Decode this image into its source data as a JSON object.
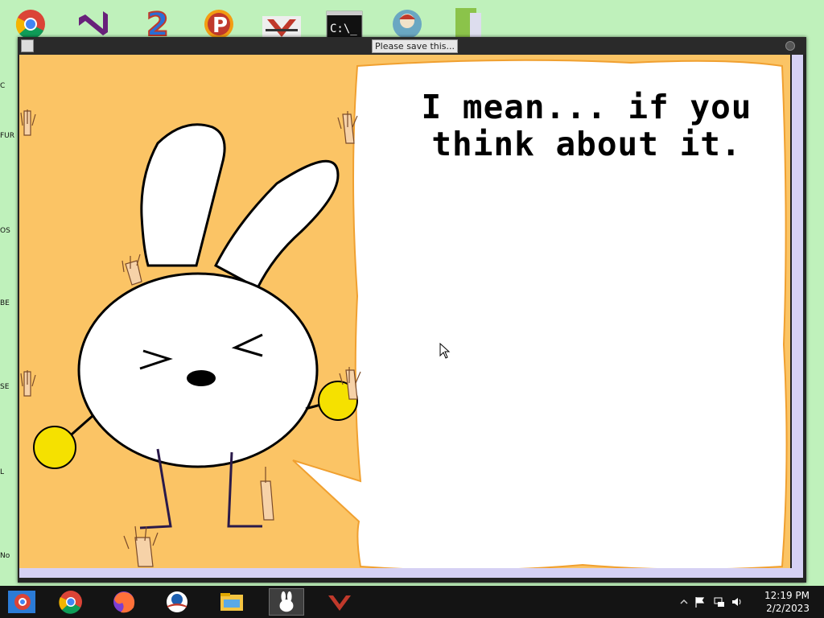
{
  "window": {
    "title": "Please save this..."
  },
  "bubble": {
    "text": "I mean... if you think about it."
  },
  "desktop": {
    "icons": [
      "chrome-icon",
      "visual-studio-icon",
      "app-2-icon",
      "p-app-icon",
      "red-v-app-icon",
      "command-prompt-icon",
      "globe-app-icon",
      "document-app-icon"
    ],
    "left_labels": [
      "C",
      "FUR",
      "OS",
      "BE",
      "SE",
      "L",
      "No"
    ]
  },
  "taskbar": {
    "apps": [
      "chrome-beta-icon",
      "chrome-icon",
      "firefox-icon",
      "obama-logo-icon",
      "file-explorer-icon",
      "bunny-app-icon",
      "red-v-app-icon"
    ],
    "active_app": "bunny-app-icon"
  },
  "clock": {
    "time": "12:19 PM",
    "date": "2/2/2023"
  },
  "colors": {
    "canvas": "#fbc465",
    "desktop": "#bff1bb",
    "taskbar": "#141414"
  }
}
